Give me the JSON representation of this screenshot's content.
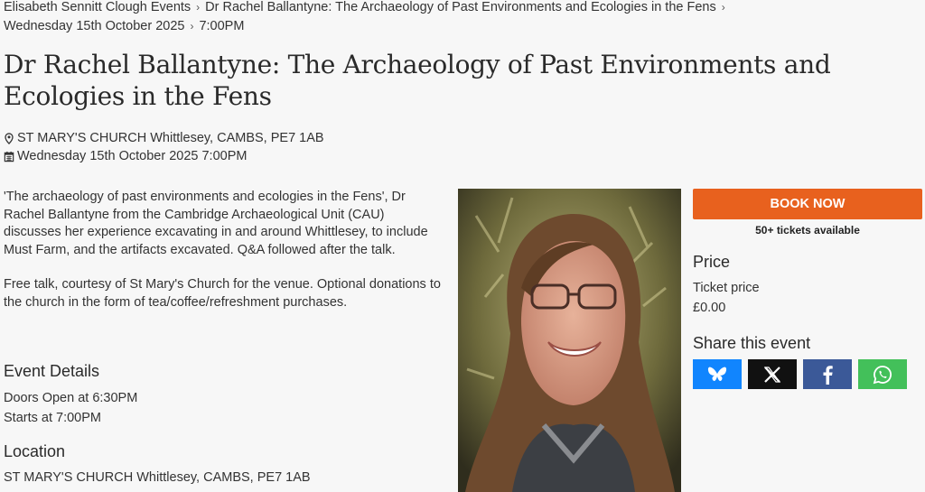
{
  "breadcrumb": {
    "item1": "Elisabeth Sennitt Clough Events",
    "item2": "Dr Rachel Ballantyne: The Archaeology of Past Environments and Ecologies in the Fens",
    "item3": "Wednesday 15th October 2025",
    "item4": "7:00PM",
    "separator": "›"
  },
  "event": {
    "title": "Dr Rachel Ballantyne: The Archaeology of Past Environments and Ecologies in the Fens",
    "venue": "ST MARY'S CHURCH Whittlesey, CAMBS, PE7 1AB",
    "datetime": "Wednesday 15th October 2025 7:00PM",
    "description": [
      "'The archaeology of past environments and ecologies in the Fens', Dr Rachel Ballantyne from the Cambridge Archaeological Unit (CAU) discusses her experience excavating in and around Whittlesey, to include Must Farm, and the artifacts excavated. Q&A followed after the talk.",
      "Free talk, courtesy of St Mary's Church for the venue. Optional donations to the church in the form of tea/coffee/refreshment purchases."
    ]
  },
  "details": {
    "heading": "Event Details",
    "doors": "Doors Open at 6:30PM",
    "starts": "Starts at 7:00PM"
  },
  "location": {
    "heading": "Location",
    "address": "ST MARY'S CHURCH Whittlesey, CAMBS, PE7 1AB"
  },
  "sidebar": {
    "book_label": "BOOK NOW",
    "availability": "50+ tickets available",
    "price_heading": "Price",
    "ticket_label": "Ticket price",
    "ticket_value": "£0.00",
    "share_heading": "Share this event"
  },
  "share_buttons": [
    {
      "name": "bluesky",
      "icon": "butterfly-icon",
      "color": "#1185fe"
    },
    {
      "name": "x",
      "icon": "x-icon",
      "color": "#111111"
    },
    {
      "name": "facebook",
      "icon": "facebook-icon",
      "color": "#3b5998"
    },
    {
      "name": "whatsapp",
      "icon": "whatsapp-icon",
      "color": "#43c05a"
    }
  ],
  "colors": {
    "accent": "#e8611e",
    "background": "#f7f7f7"
  }
}
